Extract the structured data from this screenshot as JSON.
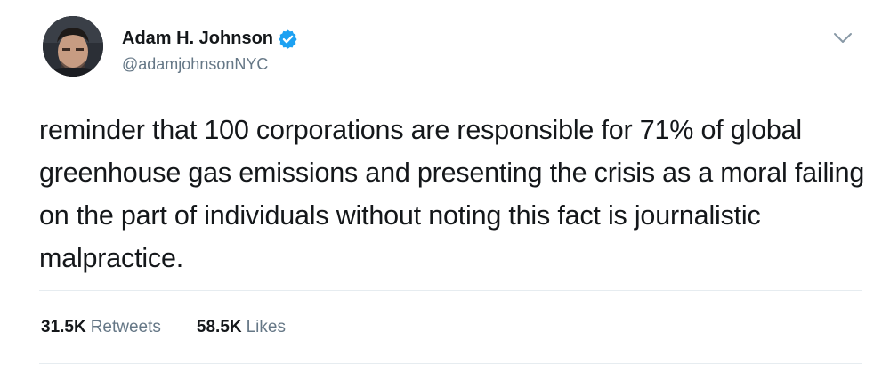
{
  "author": {
    "name": "Adam H. Johnson",
    "handle": "@adamjohnsonNYC",
    "verified": true,
    "avatar_icon": "profile-photo"
  },
  "menu_icon": "chevron-down-icon",
  "tweet": {
    "text": "reminder that 100 corporations are responsible for 71% of global greenhouse gas emissions and presenting the crisis as a moral failing on the part of individuals without noting this fact is journalistic malpractice."
  },
  "stats": {
    "retweets_count": "31.5K",
    "retweets_label": "Retweets",
    "likes_count": "58.5K",
    "likes_label": "Likes"
  },
  "colors": {
    "text_primary": "#14171a",
    "text_secondary": "#657786",
    "verified_blue": "#1da1f2",
    "divider": "#e6ecf0"
  }
}
